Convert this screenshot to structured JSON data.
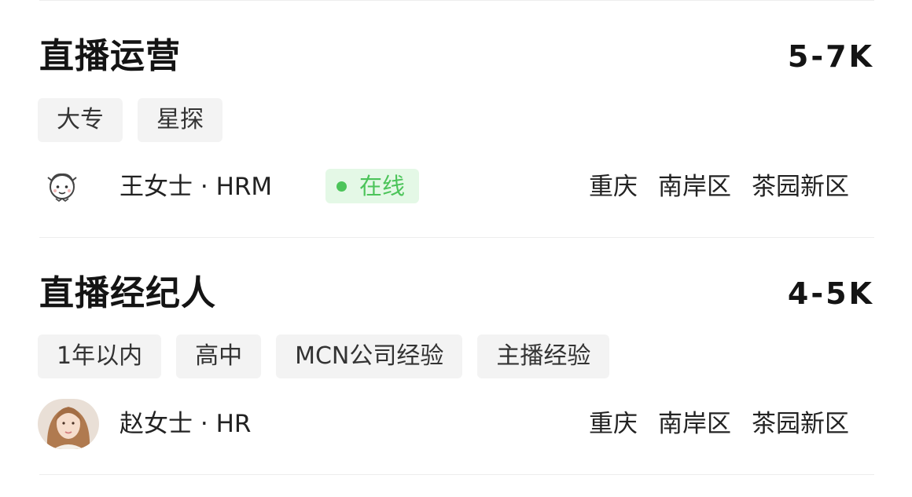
{
  "jobs": [
    {
      "title": "直播运营",
      "salary": "5-7K",
      "tags": [
        "大专",
        "星探"
      ],
      "recruiter": {
        "name": "王女士",
        "role": "HRM",
        "avatar_icon": "cartoon-avatar-icon"
      },
      "status_badge": "在线",
      "location": {
        "city": "重庆",
        "district": "南岸区",
        "area": "茶园新区"
      }
    },
    {
      "title": "直播经纪人",
      "salary": "4-5K",
      "tags": [
        "1年以内",
        "高中",
        "MCN公司经验",
        "主播经验"
      ],
      "recruiter": {
        "name": "赵女士",
        "role": "HR",
        "avatar_icon": "photo-avatar"
      },
      "location": {
        "city": "重庆",
        "district": "南岸区",
        "area": "茶园新区"
      }
    }
  ],
  "colors": {
    "online_green": "#4cc45a",
    "online_bg": "#e4f8e6",
    "tag_bg": "#f3f3f3",
    "divider": "#ededed"
  }
}
